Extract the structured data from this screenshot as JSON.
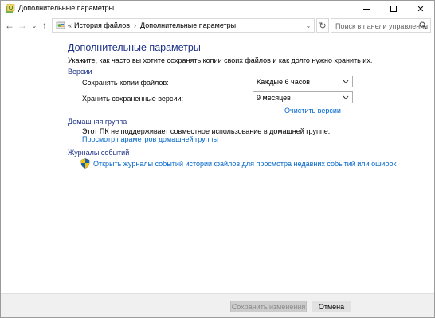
{
  "window": {
    "title": "Дополнительные параметры",
    "controls": {
      "minimize": "minimize",
      "maximize": "maximize",
      "close": "✕"
    }
  },
  "address_bar": {
    "overflow": "«",
    "breadcrumbs": [
      "История файлов",
      "Дополнительные параметры"
    ],
    "separator": "›",
    "search_placeholder": "Поиск в панели управления"
  },
  "main": {
    "heading": "Дополнительные параметры",
    "description": "Укажите, как часто вы хотите сохранять копии своих файлов и как долго нужно хранить их.",
    "versions": {
      "title": "Версии",
      "save_copies_label": "Сохранять копии файлов:",
      "save_copies_value": "Каждые 6 часов",
      "keep_versions_label": "Хранить сохраненные версии:",
      "keep_versions_value": "9 месяцев",
      "clean_link": "Очистить версии"
    },
    "homegroup": {
      "title": "Домашняя группа",
      "status": "Этот ПК не поддерживает совместное использование в домашней группе.",
      "link": "Просмотр параметров домашней группы"
    },
    "event_logs": {
      "title": "Журналы событий",
      "link": "Открыть журналы событий истории файлов для просмотра недавних событий или ошибок"
    }
  },
  "footer": {
    "save_label": "Сохранить изменения",
    "cancel_label": "Отмена"
  },
  "colors": {
    "heading": "#1e3287",
    "link": "#0066cc",
    "focus_border": "#0078d7"
  }
}
